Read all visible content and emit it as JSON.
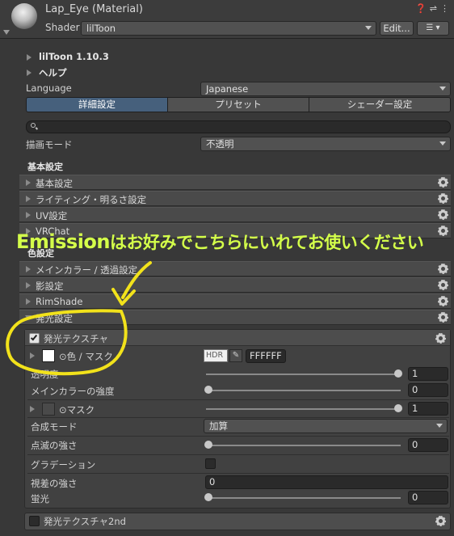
{
  "header": {
    "title": "Lap_Eye (Material)",
    "shader_label": "Shader",
    "shader_value": "lilToon",
    "edit_button": "Edit...",
    "icons": [
      "help-icon",
      "preset-icon",
      "more-icon"
    ]
  },
  "top_items": [
    {
      "label": "lilToon 1.10.3"
    },
    {
      "label": "ヘルプ"
    }
  ],
  "language": {
    "label": "Language",
    "value": "Japanese"
  },
  "tabs": [
    {
      "label": "詳細設定",
      "active": true
    },
    {
      "label": "プリセット",
      "active": false
    },
    {
      "label": "シェーダー設定",
      "active": false
    }
  ],
  "search": {
    "placeholder": ""
  },
  "render_mode": {
    "label": "描画モード",
    "value": "不透明"
  },
  "basic_settings": {
    "heading": "基本設定",
    "items": [
      {
        "label": "基本設定"
      },
      {
        "label": "ライティング・明るさ設定"
      },
      {
        "label": "UV設定"
      },
      {
        "label": "VRChat"
      }
    ]
  },
  "color_settings": {
    "heading": "色設定",
    "items": [
      {
        "label": "メインカラー / 透過設定"
      },
      {
        "label": "影設定"
      },
      {
        "label": "RimShade"
      },
      {
        "label": "発光設定"
      }
    ]
  },
  "emission": {
    "title": "発光テクスチャ",
    "enabled": true,
    "color_mask_label": "⊙色 / マスク",
    "hdr_label": "HDR",
    "color_hex": "FFFFFF",
    "transparency_label": "透明度",
    "transparency_value": "1",
    "transparency_fraction": 1.0,
    "main_color_strength_label": "メインカラーの強度",
    "main_color_strength_value": "0",
    "main_color_strength_fraction": 0.0,
    "mask_label": "⊙マスク",
    "mask_value": "1",
    "mask_fraction": 1.0,
    "blend_mode_label": "合成モード",
    "blend_mode_value": "加算",
    "blink_strength_label": "点滅の強さ",
    "blink_strength_value": "0",
    "blink_strength_fraction": 0.0,
    "gradation_label": "グラデーション",
    "gradation_enabled": false,
    "parallax_label": "視差の強さ",
    "parallax_value": "0",
    "fluorescence_label": "蛍光",
    "fluorescence_value": "0",
    "fluorescence_fraction": 0.0
  },
  "emission2": {
    "title": "発光テクスチャ2nd",
    "enabled": false
  },
  "annotation": {
    "text_en": "Emission",
    "text_jp": "はお好みでこちらにいれてお使いください",
    "color": "#d4ff4a",
    "circle_color": "#f2e21b"
  }
}
